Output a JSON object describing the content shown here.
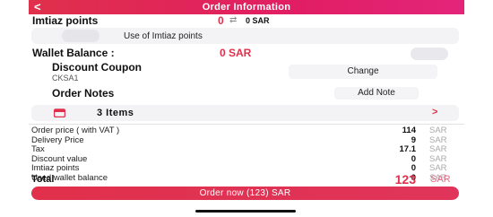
{
  "header": {
    "title": "Order Information",
    "back_icon": "chevron-left-icon"
  },
  "points": {
    "title": "Imtiaz points",
    "value": "0",
    "sar": "0 SAR",
    "icon": "swap-arrows-icon"
  },
  "points_toggle": {
    "label": "Use of Imtiaz points",
    "on": false
  },
  "wallet": {
    "label": "Wallet Balance :",
    "value": "0 SAR",
    "toggle_on": false
  },
  "coupon": {
    "title": "Discount Coupon",
    "code": "CKSA1",
    "button": "Change"
  },
  "notes": {
    "title": "Order Notes",
    "button": "Add Note"
  },
  "items": {
    "label": "3 Items",
    "chevron": ">",
    "icon": "shopping-cart-icon"
  },
  "summary": [
    {
      "label": "Order price ( with VAT )",
      "value": "114",
      "currency": "SAR"
    },
    {
      "label": "Delivery Price",
      "value": "9",
      "currency": "SAR"
    },
    {
      "label": "Tax",
      "value": "17.1",
      "currency": "SAR"
    },
    {
      "label": "Discount value",
      "value": "0",
      "currency": "SAR"
    },
    {
      "label": "Imtiaz points",
      "value": "0",
      "currency": "SAR"
    },
    {
      "label": "Used wallet balance",
      "value": "0",
      "currency": "SAR"
    }
  ],
  "total": {
    "label": "Total",
    "value": "123",
    "currency": "SAR"
  },
  "order_button": "Order now (123) SAR",
  "colors": {
    "accent": "#e0304b",
    "card": "#f3f3f5"
  }
}
